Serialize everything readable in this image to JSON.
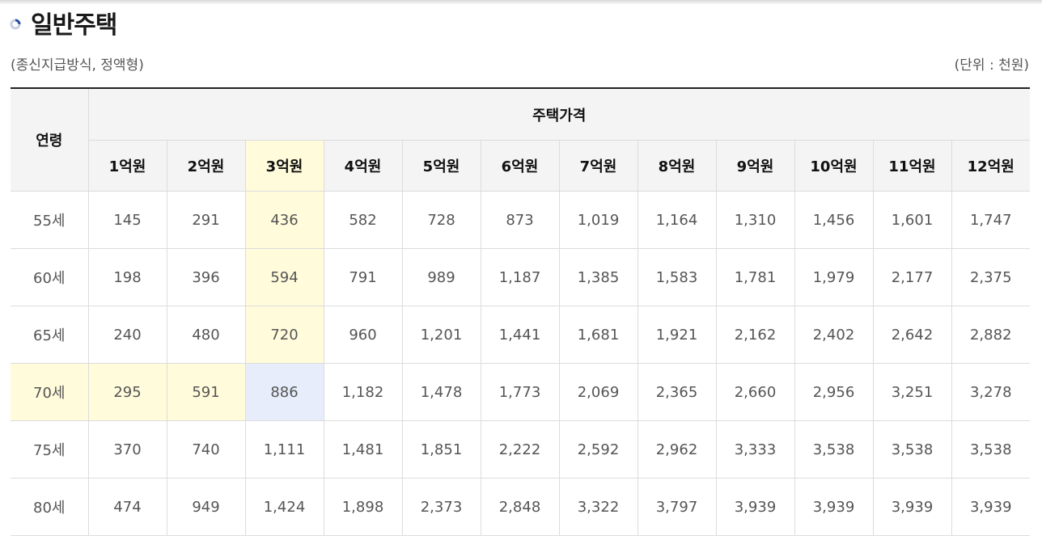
{
  "title": "일반주택",
  "subtitle": "(종신지급방식, 정액형)",
  "unit": "(단위 : 천원)",
  "table": {
    "age_header": "연령",
    "price_header": "주택가격",
    "columns": [
      "1억원",
      "2억원",
      "3억원",
      "4억원",
      "5억원",
      "6억원",
      "7억원",
      "8억원",
      "9억원",
      "10억원",
      "11억원",
      "12억원"
    ],
    "rows": [
      {
        "age": "55세",
        "values": [
          "145",
          "291",
          "436",
          "582",
          "728",
          "873",
          "1,019",
          "1,164",
          "1,310",
          "1,456",
          "1,601",
          "1,747"
        ]
      },
      {
        "age": "60세",
        "values": [
          "198",
          "396",
          "594",
          "791",
          "989",
          "1,187",
          "1,385",
          "1,583",
          "1,781",
          "1,979",
          "2,177",
          "2,375"
        ]
      },
      {
        "age": "65세",
        "values": [
          "240",
          "480",
          "720",
          "960",
          "1,201",
          "1,441",
          "1,681",
          "1,921",
          "2,162",
          "2,402",
          "2,642",
          "2,882"
        ]
      },
      {
        "age": "70세",
        "values": [
          "295",
          "591",
          "886",
          "1,182",
          "1,478",
          "1,773",
          "2,069",
          "2,365",
          "2,660",
          "2,956",
          "3,251",
          "3,278"
        ]
      },
      {
        "age": "75세",
        "values": [
          "370",
          "740",
          "1,111",
          "1,481",
          "1,851",
          "2,222",
          "2,592",
          "2,962",
          "3,333",
          "3,538",
          "3,538",
          "3,538"
        ]
      },
      {
        "age": "80세",
        "values": [
          "474",
          "949",
          "1,424",
          "1,898",
          "2,373",
          "2,848",
          "3,322",
          "3,797",
          "3,939",
          "3,939",
          "3,939",
          "3,939"
        ]
      }
    ]
  },
  "colors": {
    "highlight_yellow": "#fffbdb",
    "highlight_blue": "#e7edfb",
    "header_bg": "#f4f4f4",
    "bullet_icon": "#2a4ea0"
  }
}
